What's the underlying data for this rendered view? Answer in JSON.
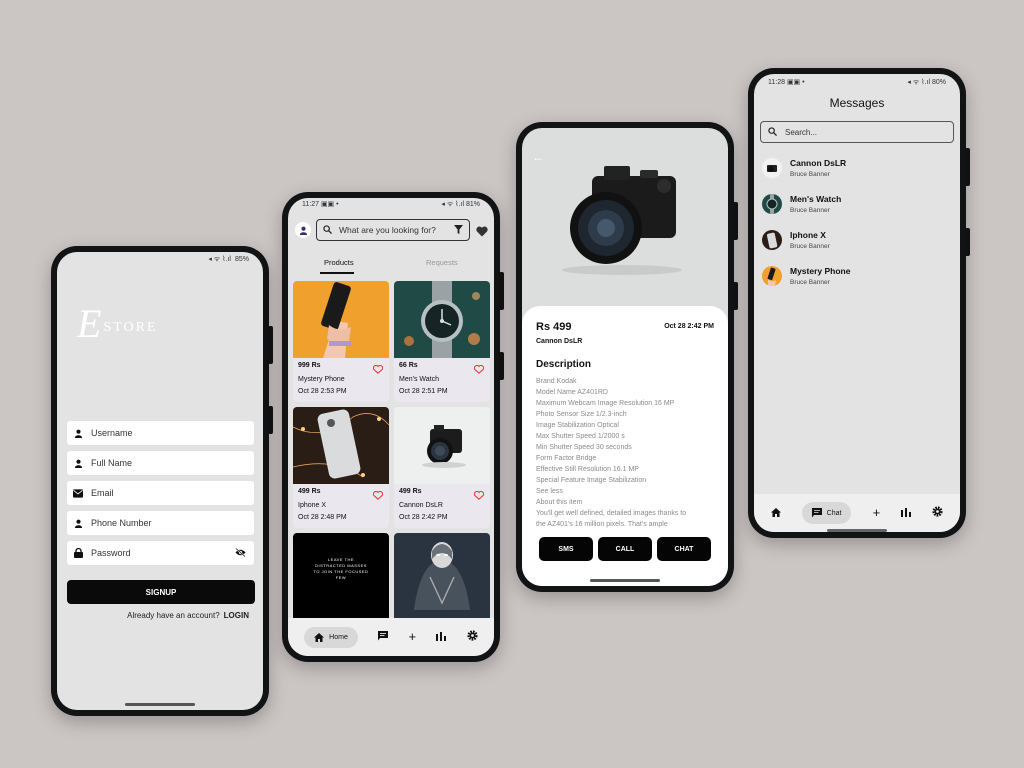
{
  "statusbar": {
    "battery_1": "85%",
    "time_2": "11:27",
    "battery_2": "81%",
    "time_4": "11:28",
    "battery_4": "80%"
  },
  "signup_screen": {
    "logo_letter": "E",
    "logo_word": "STORE",
    "fields": [
      {
        "placeholder": "Username",
        "icon": "person-icon"
      },
      {
        "placeholder": "Full Name",
        "icon": "person-icon"
      },
      {
        "placeholder": "Email",
        "icon": "mail-icon"
      },
      {
        "placeholder": "Phone Number",
        "icon": "person-icon"
      },
      {
        "placeholder": "Password",
        "icon": "lock-icon"
      }
    ],
    "signup_label": "SIGNUP",
    "already_text": "Already have an account?",
    "login_label": "LOGIN"
  },
  "products_screen": {
    "search_placeholder": "What are you looking for?",
    "tabs": [
      "Products",
      "Requests"
    ],
    "products": [
      {
        "price": "999 Rs",
        "name": "Mystery Phone",
        "date": "Oct 28 2:53 PM"
      },
      {
        "price": "66 Rs",
        "name": "Men's Watch",
        "date": "Oct 28 2:51 PM"
      },
      {
        "price": "499 Rs",
        "name": "Iphone X",
        "date": "Oct 28 2:48 PM"
      },
      {
        "price": "499 Rs",
        "name": "Cannon DsLR",
        "date": "Oct 28 2:42 PM"
      }
    ],
    "poster_text": "LEAVE THE DISTRACTED MASSES TO JOIN THE FOCUSED FEW",
    "nav": {
      "home_label": "Home"
    }
  },
  "detail_screen": {
    "price": "Rs 499",
    "date": "Oct 28 2:42 PM",
    "name": "Cannon DsLR",
    "description_title": "Description",
    "description_lines": [
      "Brand Kodak",
      "Model Name AZ401RD",
      "Maximum Webcam Image Resolution 16 MP",
      "Photo Sensor Size 1/2.3-inch",
      "Image Stabilization Optical",
      "Max Shutter Speed 1/2000 s",
      "Min Shutter Speed 30 seconds",
      "Form Factor Bridge",
      "Effective Still Resolution 16.1 MP",
      "Special Feature Image Stabilization",
      "See less",
      "About this item",
      "You'll get well defined, detailed images thanks to",
      "the AZ401's 16 million pixels. That's ample"
    ],
    "buttons": {
      "sms": "SMS",
      "call": "CALL",
      "chat": "CHAT"
    }
  },
  "messages_screen": {
    "title": "Messages",
    "search_placeholder": "Search...",
    "conversations": [
      {
        "name": "Cannon DsLR",
        "user": "Bruce Banner"
      },
      {
        "name": "Men's Watch",
        "user": "Bruce Banner"
      },
      {
        "name": "Iphone X",
        "user": "Bruce Banner"
      },
      {
        "name": "Mystery Phone",
        "user": "Bruce Banner"
      }
    ],
    "nav": {
      "chat_label": "Chat"
    }
  },
  "colors": {
    "background": "#cbc5c4",
    "screen": "#e3e3e3",
    "accent_red": "#e53935",
    "black": "#0a0a0a"
  }
}
